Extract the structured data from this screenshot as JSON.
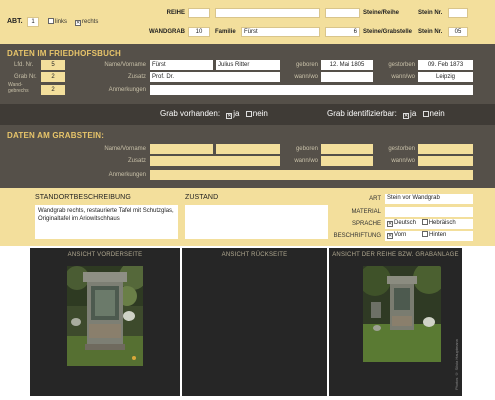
{
  "header": {
    "abt_label": "ABT.",
    "abt_value": "1",
    "links_label": "links",
    "links_checked": false,
    "rechts_label": "rechts",
    "rechts_checked": true,
    "reihe_label": "REIHE",
    "reihe_value": "",
    "steine_reihe_label": "Steine/Reihe",
    "steine_reihe_value": "",
    "stein_nr_label": "Stein Nr.",
    "stein_nr_value": "",
    "wandgrab_label": "WANDGRAB",
    "wandgrab_value": "10",
    "familie_label": "Familie",
    "familie_value": "Fürst",
    "steine_grabstelle_value": "6",
    "steine_grabstelle_label": "Steine/Grabstelle",
    "stein_nr2_label": "Stein Nr.",
    "stein_nr2_value": "05"
  },
  "friedhofsbuch": {
    "title": "DATEN IM FRIEDHOFSBUCH",
    "lfd_label": "Lfd. Nr.",
    "lfd_value": "5",
    "name_label": "Name/Vorname",
    "name_value": "Fürst",
    "vorname_value": "Julius Ritter",
    "geboren_label": "geboren",
    "geboren_value": "12. Mai 1805",
    "gestorben_label": "gestorben",
    "gestorben_value": "09. Feb 1873",
    "grab_label": "Grab Nr.",
    "grab_value": "2",
    "zusatz_label": "Zusatz",
    "zusatz_value": "Prof. Dr.",
    "wann_wo_label": "wann/wo",
    "wann_wo_value": "",
    "wann_wo2_label": "wann/wo",
    "wann_wo2_value": "Leipzig",
    "wand_label_1": "Wand-",
    "wand_label_2": "gebrechs",
    "wand_value": "2",
    "anmerkungen_label": "Anmerkungen",
    "anmerkungen_value": ""
  },
  "grab_status": {
    "vorhanden_label": "Grab vorhanden:",
    "vorhanden_ja": "ja",
    "vorhanden_nein": "nein",
    "vorhanden_ja_checked": true,
    "identifizierbar_label": "Grab identifizierbar:",
    "identifizierbar_ja": "ja",
    "identifizierbar_nein": "nein",
    "identifizierbar_ja_checked": true
  },
  "grabstein": {
    "title": "DATEN AM GRABSTEIN:",
    "name_label": "Name/Vorname",
    "zusatz_label": "Zusatz",
    "geboren_label": "geboren",
    "gestorben_label": "gestorben",
    "wann_wo_label": "wann/wo",
    "wann_wo2_label": "wann/wo",
    "anmerkungen_label": "Anmerkungen"
  },
  "standort": {
    "title": "STANDORTBESCHREIBUNG",
    "text": "Wandgrab rechts, restaurierte Tafel mit Schutzglas, Originaltafel im Ariowitschhaus",
    "zustand_title": "ZUSTAND",
    "zustand_text": "",
    "art_label": "ART",
    "art_value": "Stein vor Wandgrab",
    "material_label": "MATERIAL",
    "material_value": "",
    "sprache_label": "SPRACHE",
    "sprache_deutsch": "Deutsch",
    "sprache_hebraeisch": "Hebräisch",
    "sprache_deutsch_checked": true,
    "beschriftung_label": "BESCHRIFTUNG",
    "beschriftung_vorn": "Vorn",
    "beschriftung_hinten": "Hinten",
    "beschriftung_vorn_checked": true
  },
  "photos": {
    "vorderseite": "ANSICHT VORDERSEITE",
    "rueckseite": "ANSICHT RÜCKSEITE",
    "reihe": "ANSICHT DER REIHE BZW. GRABANLAGE",
    "credit": "Photos © Silvia Hauptmann"
  },
  "colors": {
    "cream": "#f3df9c",
    "dark": "#555049",
    "accent": "#e8c56a"
  }
}
